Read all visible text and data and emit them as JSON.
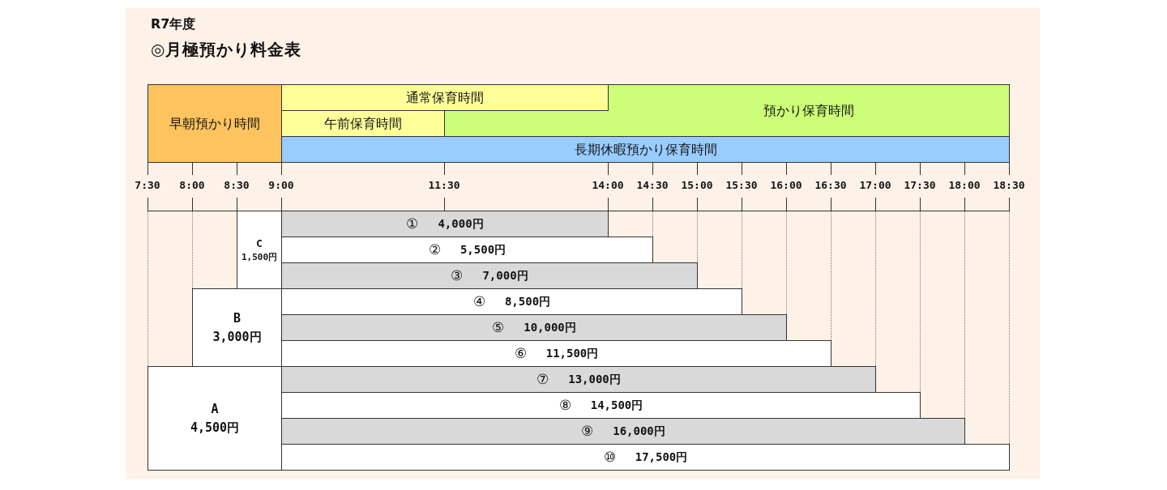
{
  "year": "R7年度",
  "title": "◎月極預かり料金表",
  "bands": [
    {
      "label": "早朝預かり時間",
      "color": "#fcc35f"
    },
    {
      "label": "通常保育時間",
      "color": "#ffff99"
    },
    {
      "label": "預かり保育時間",
      "color": "#ccff77"
    },
    {
      "label": "午前保育時間",
      "color": "#ffff99"
    },
    {
      "label": "長期休暇預かり保育時間",
      "color": "#99ccff"
    }
  ],
  "times": [
    "7:30",
    "8:00",
    "8:30",
    "9:00",
    "11:30",
    "14:00",
    "14:30",
    "15:00",
    "15:30",
    "16:00",
    "16:30",
    "17:00",
    "17:30",
    "18:00",
    "18:30"
  ],
  "groups": [
    {
      "label": "C",
      "fee": "1,500円",
      "plans": [
        {
          "number": "①",
          "fee": "4,000円",
          "shaded": true
        },
        {
          "number": "②",
          "fee": "5,500円",
          "shaded": false
        },
        {
          "number": "③",
          "fee": "7,000円",
          "shaded": true
        }
      ]
    },
    {
      "label": "B",
      "fee": "3,000円",
      "plans": [
        {
          "number": "④",
          "fee": "8,500円",
          "shaded": false
        },
        {
          "number": "⑤",
          "fee": "10,000円",
          "shaded": true
        },
        {
          "number": "⑥",
          "fee": "11,500円",
          "shaded": false
        }
      ]
    },
    {
      "label": "A",
      "fee": "4,500円",
      "plans": [
        {
          "number": "⑦",
          "fee": "13,000円",
          "shaded": true
        },
        {
          "number": "⑧",
          "fee": "14,500円",
          "shaded": false
        },
        {
          "number": "⑨",
          "fee": "16,000円",
          "shaded": true
        },
        {
          "number": "⑩",
          "fee": "17,500円",
          "shaded": false
        }
      ]
    }
  ]
}
